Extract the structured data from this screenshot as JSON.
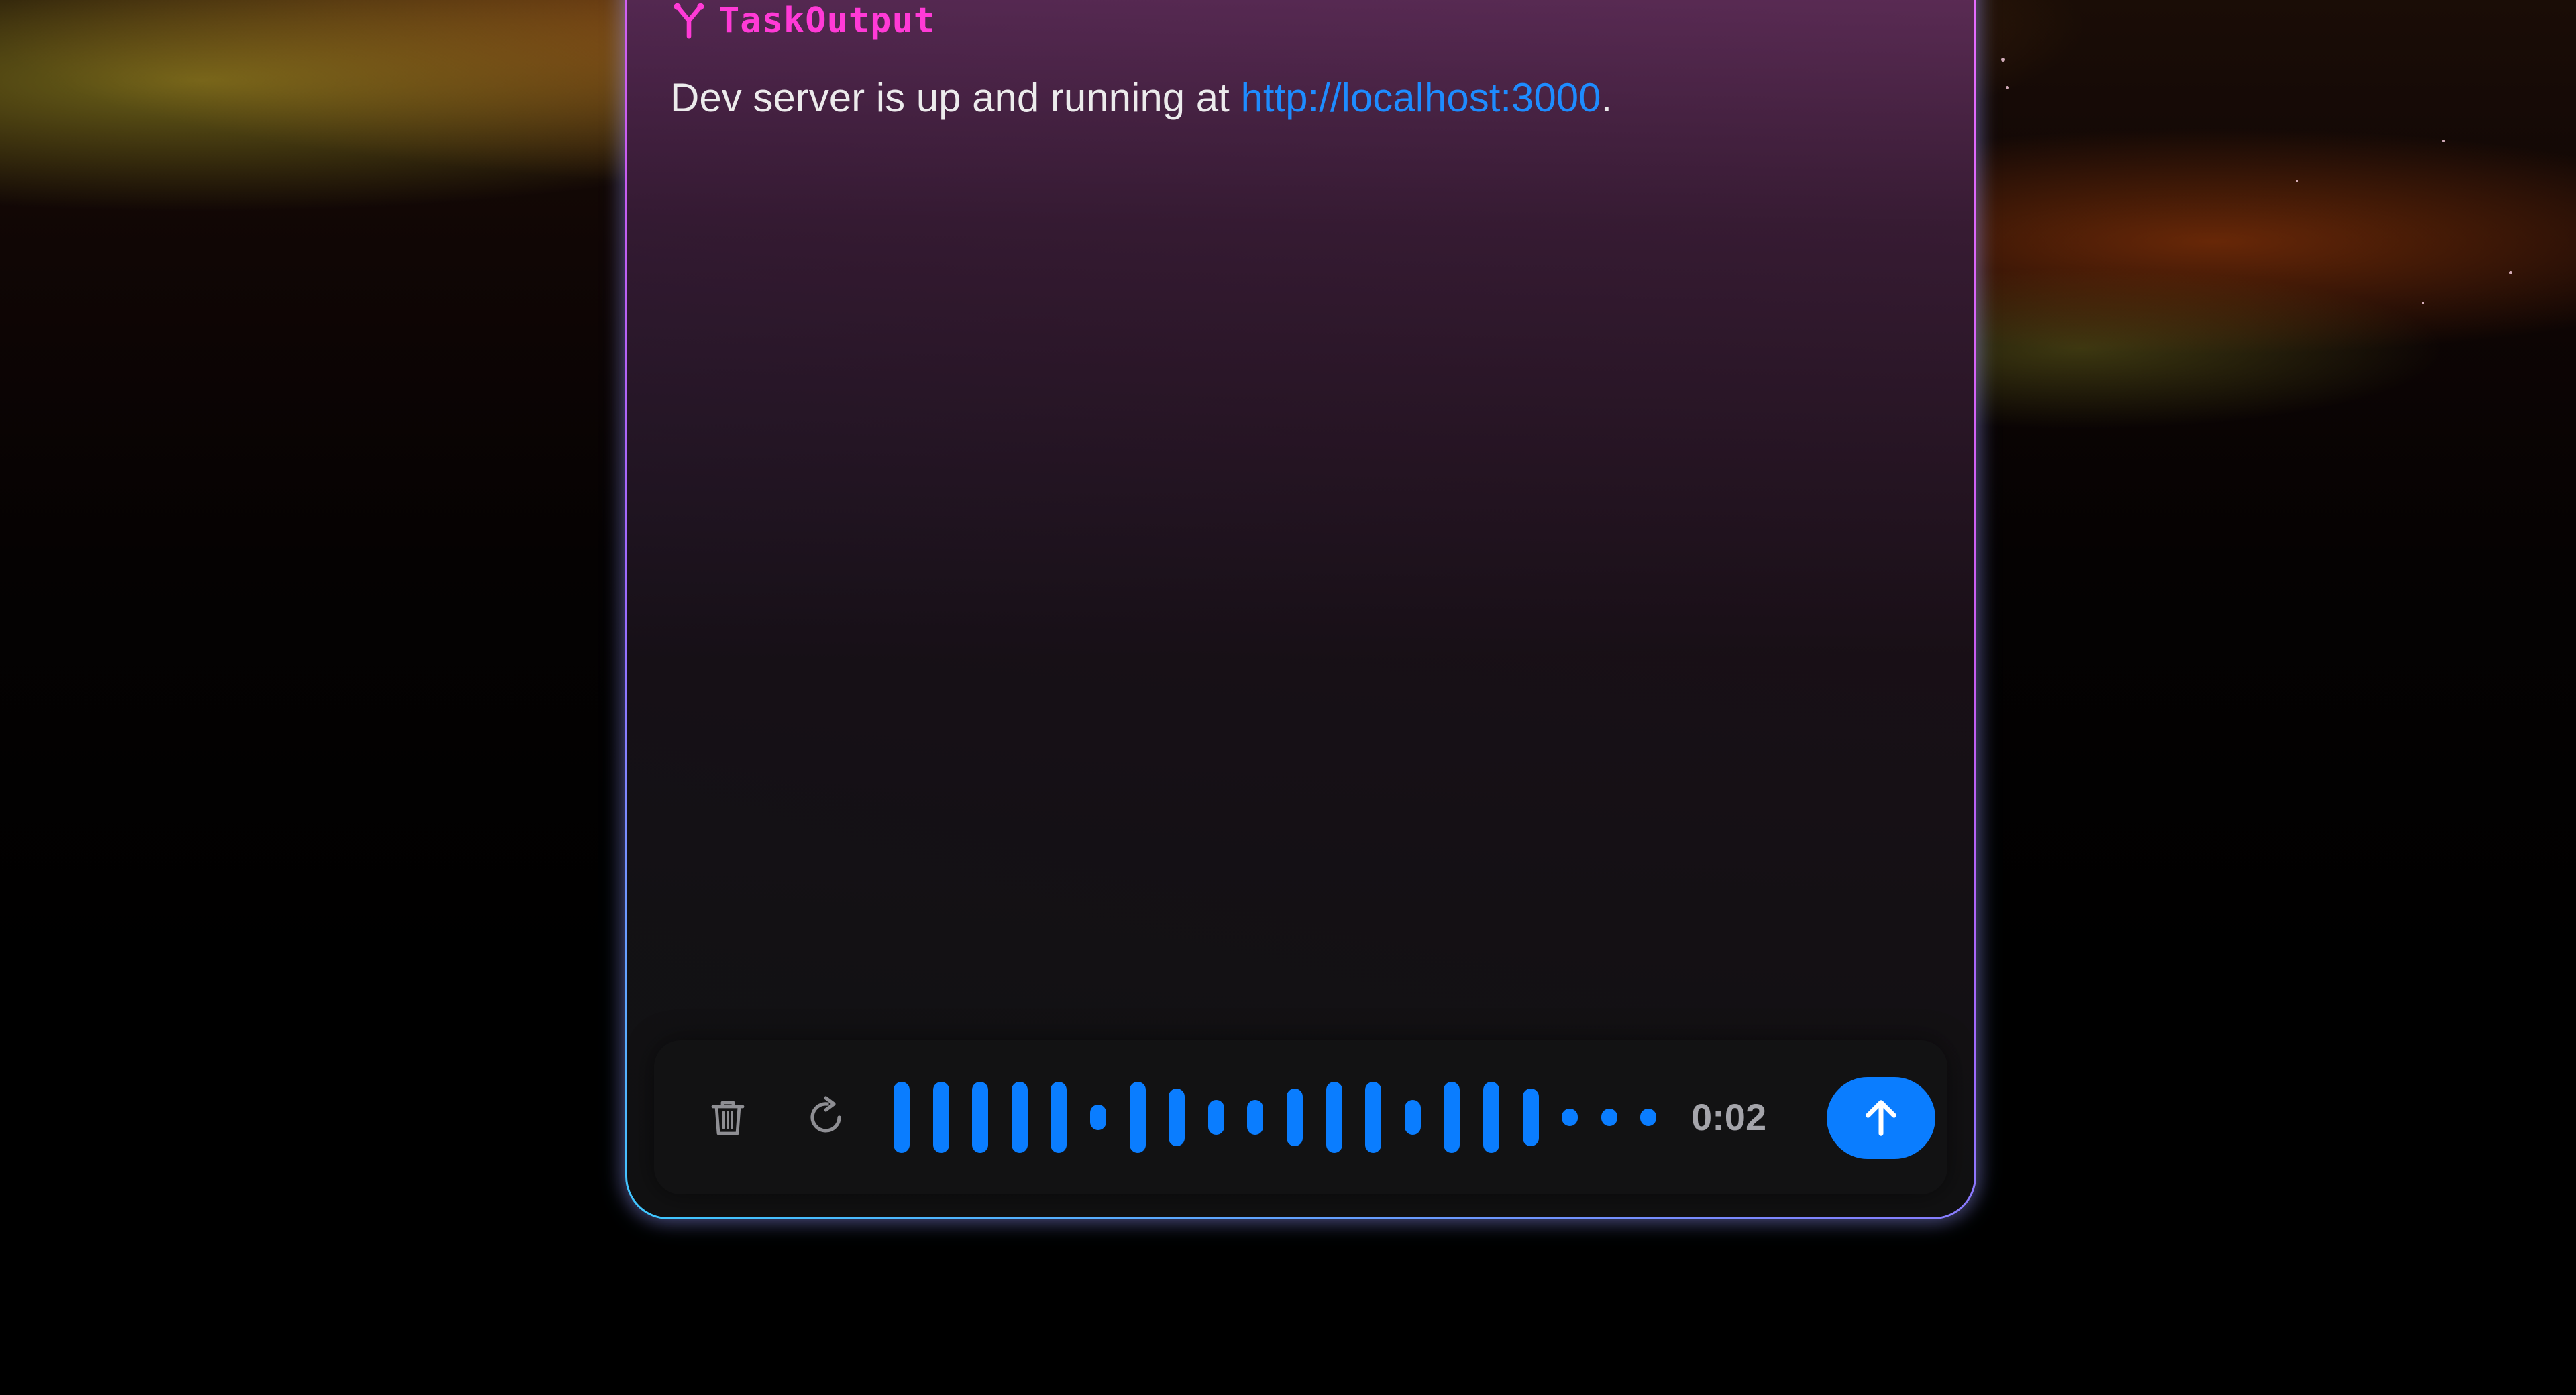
{
  "tool_output": {
    "tool_name": "TaskOutput",
    "message_prefix": "Dev server is up and running at ",
    "link_text": "http://localhost:3000",
    "message_suffix": "."
  },
  "recorder": {
    "elapsed": "0:02",
    "waveform_levels": [
      0.5,
      0.5,
      0.5,
      0.5,
      0.5,
      0.18,
      0.5,
      0.4,
      0.24,
      0.24,
      0.4,
      0.5,
      0.5,
      0.24,
      0.5,
      0.5,
      0.4,
      0.12,
      0.12,
      0.12
    ]
  },
  "icons": {
    "branch": "branch-icon",
    "delete": "trash-icon",
    "rerecord": "rotate-cw-icon",
    "send": "arrow-up-icon"
  },
  "colors": {
    "tool_name": "#ff3ad6",
    "link": "#1e8cff",
    "accent": "#0a7dff",
    "timer": "#a4a4aa"
  }
}
